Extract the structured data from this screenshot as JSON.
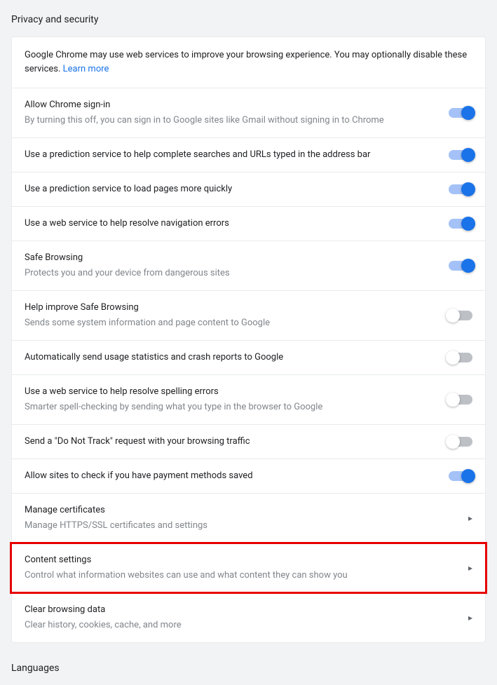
{
  "section": {
    "title": "Privacy and security"
  },
  "banner": {
    "text": "Google Chrome may use web services to improve your browsing experience. You may optionally disable these services. ",
    "link": "Learn more"
  },
  "items": [
    {
      "label": "Allow Chrome sign-in",
      "sub": "By turning this off, you can sign in to Google sites like Gmail without signing in to Chrome",
      "type": "toggle",
      "state": "on"
    },
    {
      "label": "Use a prediction service to help complete searches and URLs typed in the address bar",
      "sub": "",
      "type": "toggle",
      "state": "on"
    },
    {
      "label": "Use a prediction service to load pages more quickly",
      "sub": "",
      "type": "toggle",
      "state": "on"
    },
    {
      "label": "Use a web service to help resolve navigation errors",
      "sub": "",
      "type": "toggle",
      "state": "on"
    },
    {
      "label": "Safe Browsing",
      "sub": "Protects you and your device from dangerous sites",
      "type": "toggle",
      "state": "on"
    },
    {
      "label": "Help improve Safe Browsing",
      "sub": "Sends some system information and page content to Google",
      "type": "toggle",
      "state": "off"
    },
    {
      "label": "Automatically send usage statistics and crash reports to Google",
      "sub": "",
      "type": "toggle",
      "state": "off"
    },
    {
      "label": "Use a web service to help resolve spelling errors",
      "sub": "Smarter spell-checking by sending what you type in the browser to Google",
      "type": "toggle",
      "state": "off"
    },
    {
      "label": "Send a \"Do Not Track\" request with your browsing traffic",
      "sub": "",
      "type": "toggle",
      "state": "off"
    },
    {
      "label": "Allow sites to check if you have payment methods saved",
      "sub": "",
      "type": "toggle",
      "state": "on"
    },
    {
      "label": "Manage certificates",
      "sub": "Manage HTTPS/SSL certificates and settings",
      "type": "link",
      "state": ""
    },
    {
      "label": "Content settings",
      "sub": "Control what information websites can use and what content they can show you",
      "type": "link",
      "state": "",
      "highlight": true
    },
    {
      "label": "Clear browsing data",
      "sub": "Clear history, cookies, cache, and more",
      "type": "link",
      "state": ""
    }
  ],
  "next_section": {
    "title": "Languages"
  }
}
